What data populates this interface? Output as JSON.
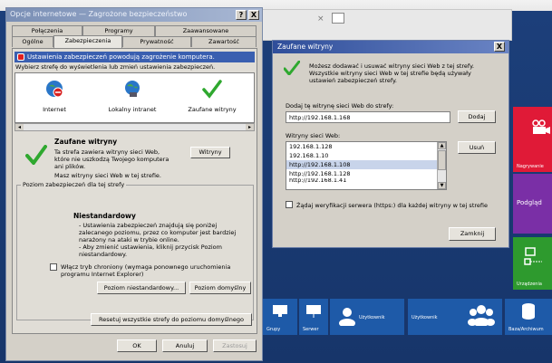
{
  "background": {
    "tiles": [
      {
        "label": "",
        "color": "#e01a37",
        "icon": "camera-icon"
      },
      {
        "label": "Nagrywanie",
        "color": "#d61b2f",
        "icon": ""
      },
      {
        "label": "Podgląd",
        "color": "#7a2fa6",
        "icon": ""
      },
      {
        "label": "Urządzenia",
        "color": "#2e9a2e",
        "icon": "devices-icon"
      },
      {
        "label": "Grupy",
        "color": "#1e5aa8",
        "icon": "monitor-icon"
      },
      {
        "label": "Serwer",
        "color": "#1e5aa8",
        "icon": "server-icon"
      },
      {
        "label": "Użytkownik",
        "color": "#1e5aa8",
        "icon": "user-icon"
      },
      {
        "label": "Użytkownik",
        "color": "#1e5aa8",
        "icon": "users-icon"
      },
      {
        "label": "Baza/Archiwum",
        "color": "#1e5aa8",
        "icon": "database-icon"
      }
    ]
  },
  "options_dialog": {
    "title": "Opcje internetowe — Zagrożone bezpieczeństwo",
    "help_btn": "?",
    "close_btn": "X",
    "tabs_row1": [
      "Połączenia",
      "Programy",
      "Zaawansowane"
    ],
    "tabs_row2": [
      "Ogólne",
      "Zabezpieczenia",
      "Prywatność",
      "Zawartość"
    ],
    "warning": "Ustawienia zabezpieczeń powodują zagrożenie komputera.",
    "select_zone_text": "Wybierz strefę do wyświetlenia lub zmień ustawienia zabezpieczeń.",
    "zones": [
      {
        "label": "Internet",
        "icon": "globe-blocked-icon"
      },
      {
        "label": "Lokalny intranet",
        "icon": "intranet-globe-icon"
      },
      {
        "label": "Zaufane witryny",
        "icon": "checkmark-icon"
      }
    ],
    "zone_title": "Zaufane witryny",
    "zone_desc": "Ta strefa zawiera witryny sieci Web, które nie uszkodzą Twojego komputera ani plików.",
    "sites_button": "Witryny",
    "zone_note": "Masz witryny sieci Web w tej strefie.",
    "level_group": "Poziom zabezpieczeń dla tej strefy",
    "level_title": "Niestandardowy",
    "level_lines": [
      "- Ustawienia niestandardowe",
      "- Ustawienia zabezpieczeń znajdują się poniżej",
      "zalecanego poziomu, przez co komputer jest bardziej",
      "narażony na ataki w trybie online.",
      "- Aby zmienić ustawienia, kliknij przycisk Poziom",
      "niestandardowy."
    ],
    "protected_mode": "Włącz tryb chroniony (wymaga ponownego uruchomienia programu Internet Explorer)",
    "custom_level_btn": "Poziom niestandardowy...",
    "default_level_btn": "Poziom domyślny",
    "reset_btn": "Resetuj wszystkie strefy do poziomu domyślnego",
    "ok_btn": "OK",
    "cancel_btn": "Anuluj",
    "apply_btn": "Zastosuj"
  },
  "trusted_dialog": {
    "title": "Zaufane witryny",
    "close_btn": "X",
    "info": "Możesz dodawać i usuwać witryny sieci Web z tej strefy. Wszystkie witryny sieci Web w tej strefie będą używały ustawień zabezpieczeń strefy.",
    "add_label": "Dodaj tę witrynę sieci Web do strefy:",
    "add_value": "http://192.168.1.168",
    "add_btn": "Dodaj",
    "list_label": "Witryny sieci Web:",
    "sites": [
      "192.168.1.128",
      "192.168.1.10",
      "http://192.168.1.108",
      "http://192.168.1.128",
      "http://192.168.1.41"
    ],
    "selected_index": 2,
    "remove_btn": "Usuń",
    "require_https": "Żądaj weryfikacji serwera (https:) dla każdej witryny w tej strefie",
    "close_label": "Zamknij"
  },
  "colors": {
    "warning_bar": "#3a5fb0",
    "title_active": "#2f4e9a",
    "check_green": "#2fa82f"
  }
}
